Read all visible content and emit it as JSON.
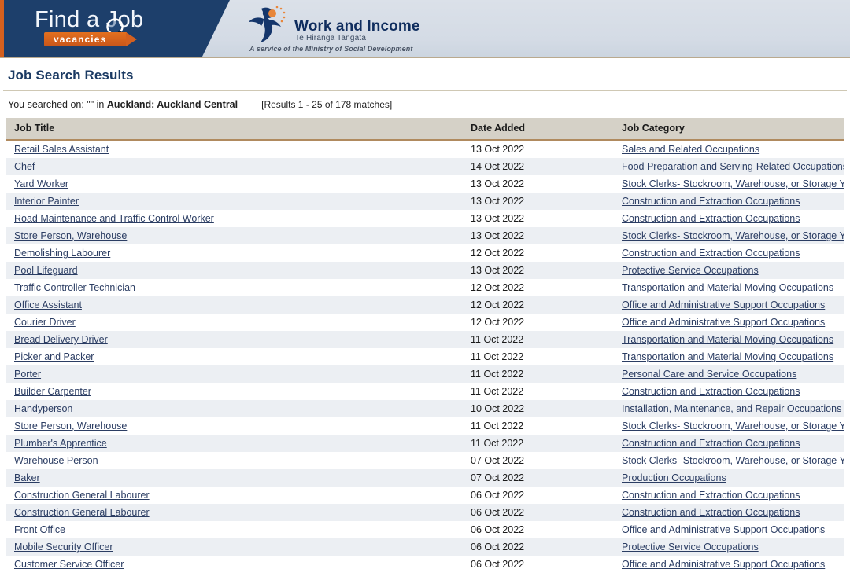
{
  "header": {
    "brand": {
      "wordmark": "Find a Job",
      "badge": "vacancies",
      "magnifier_icon": "magnifier-icon"
    },
    "agency": {
      "mark_icon": "work-and-income-koru-icon",
      "title": "Work and Income",
      "maori_title": "Te Hiranga Tangata",
      "ministry_line": "A service of the Ministry of Social Development"
    }
  },
  "page": {
    "title": "Job Search Results"
  },
  "search": {
    "prefix": "You searched on: \"\" in ",
    "location": "Auckland: Auckland Central",
    "results_count": "[Results 1 - 25 of 178 matches]"
  },
  "table": {
    "columns": [
      "Job Title",
      "Date Added",
      "Job Category"
    ],
    "rows": [
      {
        "title": "Retail Sales Assistant",
        "date": "13 Oct 2022",
        "category": "Sales and Related Occupations"
      },
      {
        "title": "Chef",
        "date": "14 Oct 2022",
        "category": "Food Preparation and Serving-Related Occupations"
      },
      {
        "title": "Yard Worker",
        "date": "13 Oct 2022",
        "category": "Stock Clerks- Stockroom, Warehouse, or Storage Yard"
      },
      {
        "title": "Interior Painter",
        "date": "13 Oct 2022",
        "category": "Construction and Extraction Occupations"
      },
      {
        "title": "Road Maintenance and Traffic Control Worker",
        "date": "13 Oct 2022",
        "category": "Construction and Extraction Occupations"
      },
      {
        "title": "Store Person, Warehouse",
        "date": "13 Oct 2022",
        "category": "Stock Clerks- Stockroom, Warehouse, or Storage Yard"
      },
      {
        "title": "Demolishing Labourer",
        "date": "12 Oct 2022",
        "category": "Construction and Extraction Occupations"
      },
      {
        "title": "Pool Lifeguard",
        "date": "13 Oct 2022",
        "category": "Protective Service Occupations"
      },
      {
        "title": "Traffic Controller Technician",
        "date": "12 Oct 2022",
        "category": "Transportation and Material Moving Occupations"
      },
      {
        "title": "Office Assistant",
        "date": "12 Oct 2022",
        "category": "Office and Administrative Support Occupations"
      },
      {
        "title": "Courier Driver",
        "date": "12 Oct 2022",
        "category": "Office and Administrative Support Occupations"
      },
      {
        "title": "Bread Delivery Driver",
        "date": "11 Oct 2022",
        "category": "Transportation and Material Moving Occupations"
      },
      {
        "title": "Picker and Packer",
        "date": "11 Oct 2022",
        "category": "Transportation and Material Moving Occupations"
      },
      {
        "title": "Porter",
        "date": "11 Oct 2022",
        "category": "Personal Care and Service Occupations"
      },
      {
        "title": "Builder Carpenter",
        "date": "11 Oct 2022",
        "category": "Construction and Extraction Occupations"
      },
      {
        "title": "Handyperson",
        "date": "10 Oct 2022",
        "category": "Installation, Maintenance, and Repair Occupations"
      },
      {
        "title": "Store Person, Warehouse",
        "date": "11 Oct 2022",
        "category": "Stock Clerks- Stockroom, Warehouse, or Storage Yard"
      },
      {
        "title": "Plumber's Apprentice",
        "date": "11 Oct 2022",
        "category": "Construction and Extraction Occupations"
      },
      {
        "title": "Warehouse Person",
        "date": "07 Oct 2022",
        "category": "Stock Clerks- Stockroom, Warehouse, or Storage Yard"
      },
      {
        "title": "Baker",
        "date": "07 Oct 2022",
        "category": "Production Occupations"
      },
      {
        "title": "Construction General Labourer",
        "date": "06 Oct 2022",
        "category": "Construction and Extraction Occupations"
      },
      {
        "title": "Construction General Labourer",
        "date": "06 Oct 2022",
        "category": "Construction and Extraction Occupations"
      },
      {
        "title": "Front Office",
        "date": "06 Oct 2022",
        "category": "Office and Administrative Support Occupations"
      },
      {
        "title": "Mobile Security Officer",
        "date": "06 Oct 2022",
        "category": "Protective Service Occupations"
      },
      {
        "title": "Customer Service Officer",
        "date": "06 Oct 2022",
        "category": "Office and Administrative Support Occupations"
      }
    ]
  },
  "colors": {
    "brand_navy": "#1d3f6b",
    "brand_orange": "#d4601f",
    "header_bg": "#d6dde6",
    "table_header_bg": "#d5d1c7",
    "row_stripe": "#eceff3",
    "link": "#2b3d63",
    "rule": "#cfc8b4"
  }
}
